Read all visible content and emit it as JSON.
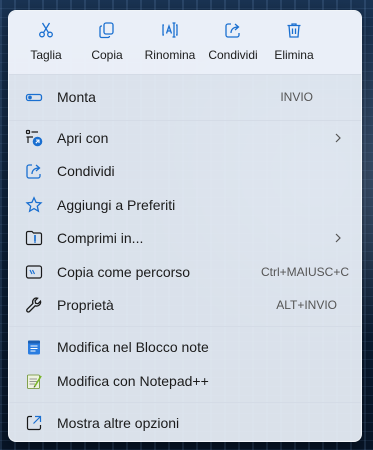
{
  "toolbar": {
    "cut": "Taglia",
    "copy": "Copia",
    "rename": "Rinomina",
    "share": "Condividi",
    "delete": "Elimina"
  },
  "items": {
    "mount": {
      "label": "Monta",
      "shortcut": "INVIO"
    },
    "open_with": {
      "label": "Apri con"
    },
    "share": {
      "label": "Condividi"
    },
    "favorites": {
      "label": "Aggiungi a Preferiti"
    },
    "compress": {
      "label": "Comprimi in..."
    },
    "copy_path": {
      "label": "Copia come percorso",
      "shortcut": "Ctrl+MAIUSC+C"
    },
    "properties": {
      "label": "Proprietà",
      "shortcut": "ALT+INVIO"
    },
    "notepad": {
      "label": "Modifica nel Blocco note"
    },
    "notepadpp": {
      "label": "Modifica con Notepad++"
    },
    "more": {
      "label": "Mostra altre opzioni"
    }
  },
  "icons": {
    "cut": "scissors-icon",
    "copy": "copy-icon",
    "rename": "rename-icon",
    "share": "share-icon",
    "delete": "trash-icon",
    "mount": "disc-drive-icon",
    "open_with": "open-with-icon",
    "favorites": "star-icon",
    "compress": "zip-folder-icon",
    "copy_path": "copy-path-icon",
    "properties": "wrench-icon",
    "notepad": "notepad-icon",
    "notepadpp": "notepadpp-icon",
    "more": "open-external-icon"
  },
  "colors": {
    "accent": "#1a6fd0",
    "menu_bg": "#e8eef7",
    "text": "#1b1b1b"
  }
}
